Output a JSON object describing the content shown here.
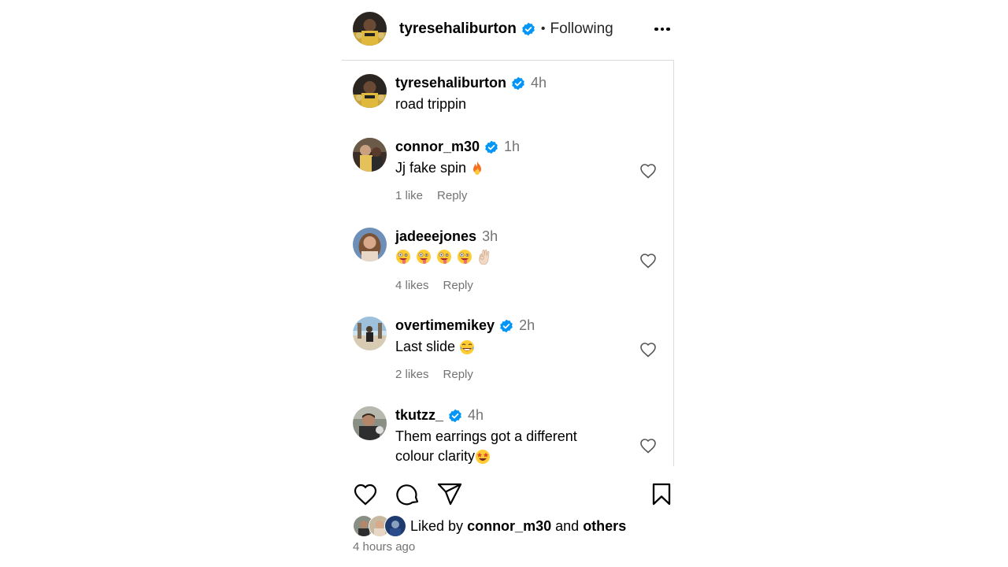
{
  "post": {
    "author": "tyresehaliburton",
    "follow_status": "Following",
    "separator": "•"
  },
  "comments": [
    {
      "username": "tyresehaliburton",
      "verified": true,
      "time": "4h",
      "text": "road trippin",
      "likes": "",
      "reply": ""
    },
    {
      "username": "connor_m30",
      "verified": true,
      "time": "1h",
      "text": "Jj fake spin ",
      "emojis": [
        "fire"
      ],
      "likes": "1 like",
      "reply": "Reply"
    },
    {
      "username": "jadeeejones",
      "verified": false,
      "time": "3h",
      "text": "",
      "emojis": [
        "zany-face",
        "zany-face",
        "zany-face",
        "zany-face",
        "ok-hand"
      ],
      "likes": "4 likes",
      "reply": "Reply"
    },
    {
      "username": "overtimemikey",
      "verified": true,
      "time": "2h",
      "text": "Last slide ",
      "emojis": [
        "tears-of-joy"
      ],
      "likes": "2 likes",
      "reply": "Reply"
    },
    {
      "username": "tkutzz_",
      "verified": true,
      "time": "4h",
      "text_line1": "Them earrings got a different",
      "text_line2": "colour clarity",
      "emojis": [
        "star-struck"
      ],
      "likes": "",
      "reply": ""
    }
  ],
  "actions": {
    "like": "heart-icon",
    "comment": "comment-icon",
    "share": "share-icon",
    "save": "bookmark-icon"
  },
  "liked_by": {
    "prefix": "Liked by",
    "user": "connor_m30",
    "conjunction": "and",
    "others": "others"
  },
  "timestamp": "4 hours ago",
  "colors": {
    "verified": "#0095f6",
    "secondary_text": "#737373",
    "border": "#dbdbdb"
  }
}
